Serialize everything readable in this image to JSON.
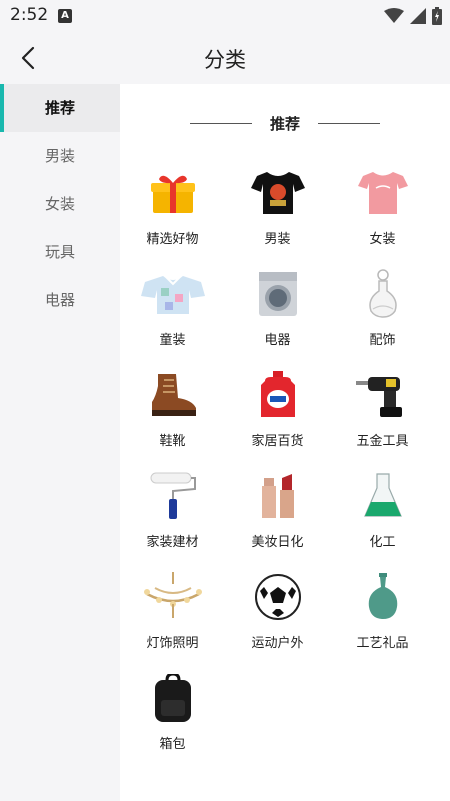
{
  "status": {
    "time": "2:52",
    "badge": "A"
  },
  "header": {
    "title": "分类"
  },
  "sidebar": {
    "items": [
      {
        "label": "推荐",
        "active": true
      },
      {
        "label": "男装",
        "active": false
      },
      {
        "label": "女装",
        "active": false
      },
      {
        "label": "玩具",
        "active": false
      },
      {
        "label": "电器",
        "active": false
      }
    ]
  },
  "section": {
    "title": "推荐"
  },
  "categories": [
    {
      "label": "精选好物",
      "icon": "gift-box-icon"
    },
    {
      "label": "男装",
      "icon": "black-tshirt-icon"
    },
    {
      "label": "女装",
      "icon": "pink-tshirt-icon"
    },
    {
      "label": "童装",
      "icon": "kids-shirt-icon"
    },
    {
      "label": "电器",
      "icon": "washing-machine-icon"
    },
    {
      "label": "配饰",
      "icon": "glass-decanter-icon"
    },
    {
      "label": "鞋靴",
      "icon": "boot-icon"
    },
    {
      "label": "家居百货",
      "icon": "detergent-bottle-icon"
    },
    {
      "label": "五金工具",
      "icon": "power-drill-icon"
    },
    {
      "label": "家装建材",
      "icon": "paint-roller-icon"
    },
    {
      "label": "美妆日化",
      "icon": "lipstick-icon"
    },
    {
      "label": "化工",
      "icon": "flask-icon"
    },
    {
      "label": "灯饰照明",
      "icon": "chandelier-icon"
    },
    {
      "label": "运动户外",
      "icon": "soccer-ball-icon"
    },
    {
      "label": "工艺礼品",
      "icon": "vase-icon"
    },
    {
      "label": "箱包",
      "icon": "backpack-icon"
    }
  ],
  "colors": {
    "accent": "#19b8ae",
    "background": "#f5f5f7"
  }
}
